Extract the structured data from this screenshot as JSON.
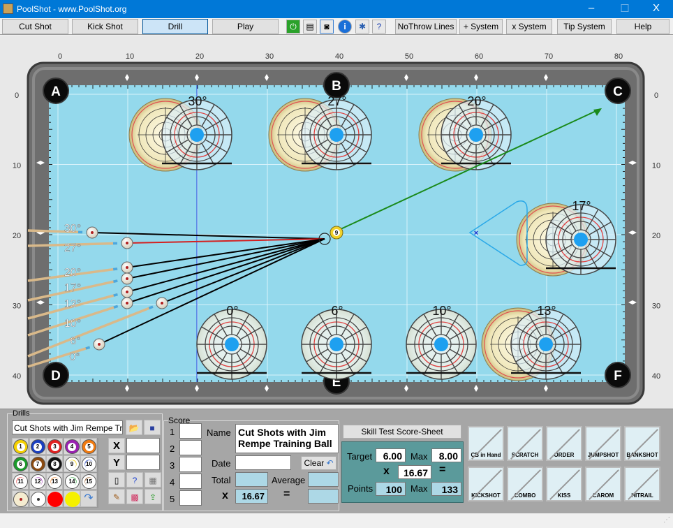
{
  "window": {
    "title": "PoolShot - www.PoolShot.org",
    "minimize": "–",
    "maximize": "☐",
    "close": "X"
  },
  "toolbar": {
    "buttons": [
      "Cut Shot",
      "Kick Shot",
      "Drill",
      "Play"
    ],
    "selected": "Drill",
    "icons": [
      "power-icon",
      "printer-icon",
      "camera-icon",
      "info-icon",
      "settings-icon",
      "help-doc-icon"
    ],
    "right_buttons": [
      "NoThrow Lines",
      "+ System",
      "x System",
      "Tip System",
      "Help"
    ]
  },
  "table": {
    "x_ticks": [
      "0",
      "10",
      "20",
      "30",
      "40",
      "50",
      "60",
      "70",
      "80"
    ],
    "y_ticks": [
      "0",
      "10",
      "20",
      "30",
      "40"
    ],
    "pockets": [
      "A",
      "B",
      "C",
      "D",
      "E",
      "F"
    ],
    "object_ball": "9",
    "diagram_angles": [
      "30°",
      "27°",
      "20°",
      "17°",
      "0°",
      "6°",
      "10°",
      "13°"
    ],
    "cue_angles": [
      "30°",
      "27°",
      "20°",
      "17°",
      "13°",
      "10°",
      "6°",
      "0°"
    ],
    "colors": {
      "cloth": "#94d9ec",
      "rail": "#6b6b6b",
      "aim_line": "#000000",
      "highlight_line": "#d42020",
      "object_path": "#1a8a1a",
      "ghost_dot": "#1ea0f0"
    }
  },
  "drills": {
    "label": "Drills",
    "name": "Cut Shots with Jim Rempe Trainir",
    "x_label": "X",
    "y_label": "Y",
    "x_value": "",
    "y_value": "",
    "balls": [
      "1",
      "2",
      "3",
      "4",
      "5",
      "6",
      "7",
      "8",
      "9",
      "10",
      "11",
      "12",
      "13",
      "14",
      "15"
    ]
  },
  "score": {
    "label": "Score",
    "rows": [
      "1",
      "2",
      "3",
      "4",
      "5"
    ],
    "name_label": "Name",
    "name_value": "Cut Shots with Jim Rempe Training Ball",
    "date_label": "Date",
    "date_value": "",
    "clear": "Clear",
    "total_label": "Total",
    "average_label": "Average",
    "x_label": "x",
    "multiplier": "16.67",
    "eq": "="
  },
  "skill": {
    "title": "Skill Test Score-Sheet",
    "target_label": "Target",
    "target": "6.00",
    "max_label": "Max",
    "max": "8.00",
    "x": "x",
    "multiplier": "16.67",
    "eq": "=",
    "points_label": "Points",
    "points": "100",
    "max2_label": "Max",
    "max2": "133"
  },
  "fouls": [
    "CB in Hand",
    "SCRATCH",
    "ORDER",
    "JUMPSHOT",
    "BANKSHOT",
    "KICKSHOT",
    "COMBO",
    "KISS",
    "CAROM",
    "HITRAIL"
  ]
}
